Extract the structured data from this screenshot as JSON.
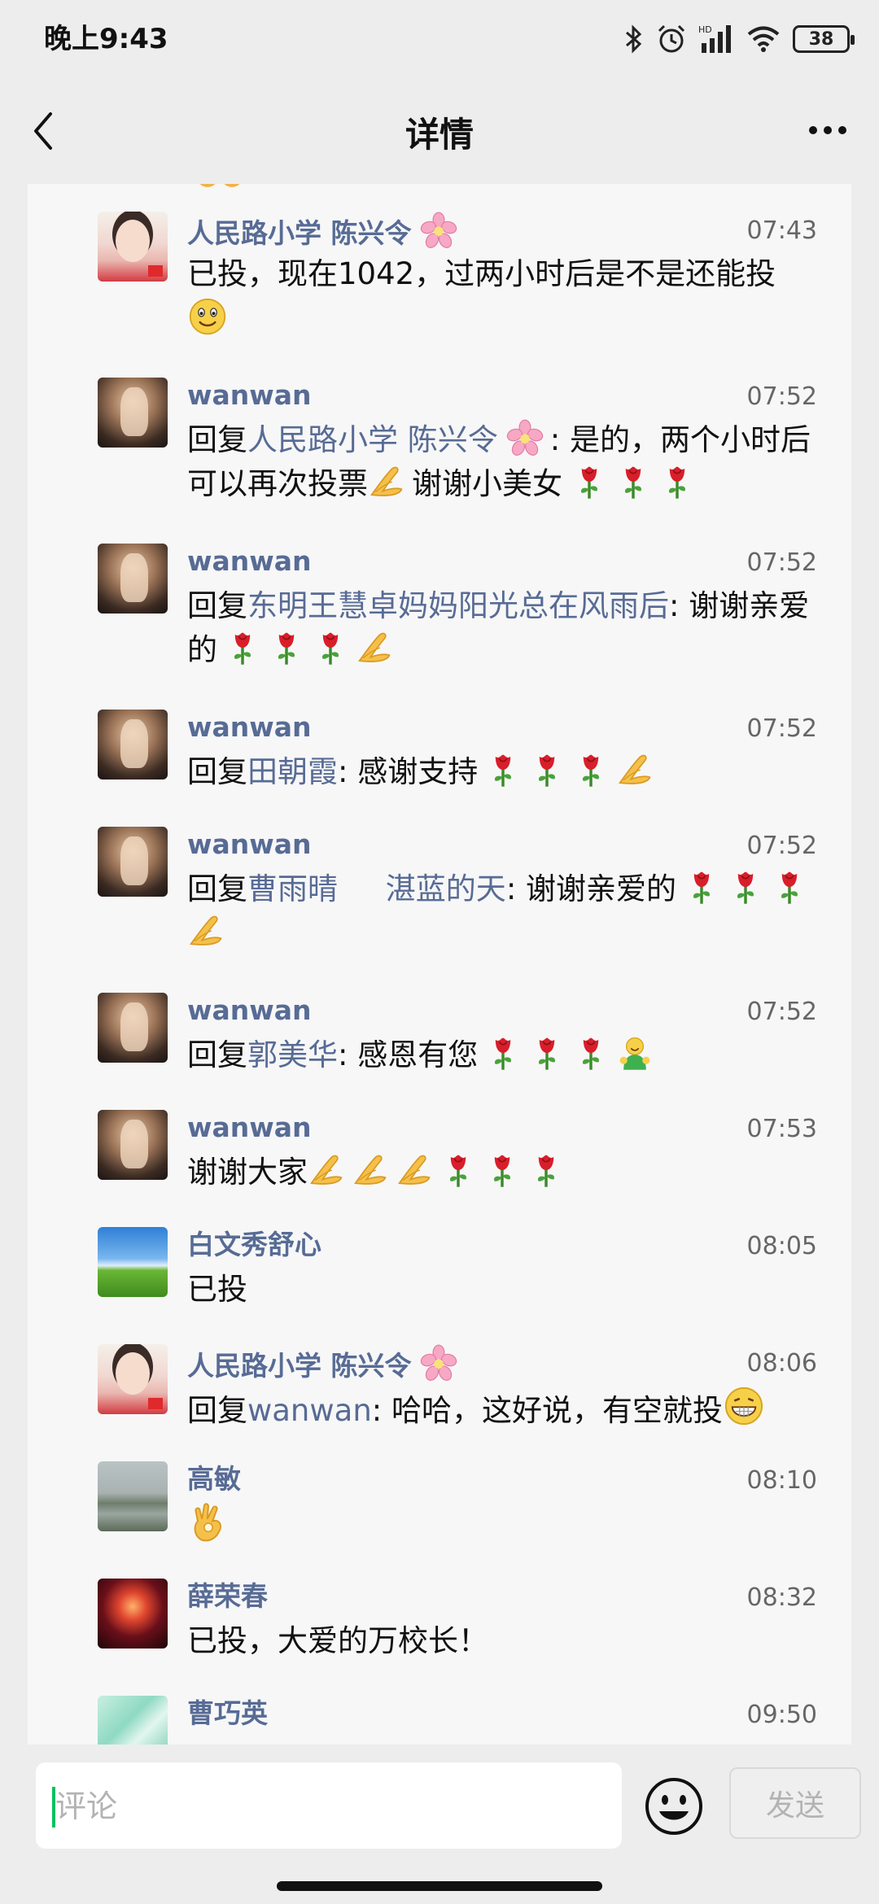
{
  "status_bar": {
    "time": "晚上9:43",
    "battery": "38"
  },
  "header": {
    "title": "详情"
  },
  "comments": [
    {
      "name": "人民路小学 陈兴令",
      "time": "07:43",
      "parts": [
        "已投，现在1042，过两小时后是不是还能投"
      ]
    },
    {
      "name": "wanwan",
      "time": "07:52",
      "parts": [
        "回复",
        "人民路小学 陈兴令",
        ": 是的，两个小时后可以再次投票",
        "谢谢小美女"
      ]
    },
    {
      "name": "wanwan",
      "time": "07:52",
      "parts": [
        "回复",
        "东明王慧卓妈妈阳光总在风雨后",
        ": 谢谢亲爱的"
      ]
    },
    {
      "name": "wanwan",
      "time": "07:52",
      "parts": [
        "回复",
        "田朝霞",
        ": 感谢支持"
      ]
    },
    {
      "name": "wanwan",
      "time": "07:52",
      "parts": [
        "回复",
        "曹雨晴     湛蓝的天",
        ": 谢谢亲爱的"
      ]
    },
    {
      "name": "wanwan",
      "time": "07:52",
      "parts": [
        "回复",
        "郭美华",
        ": 感恩有您"
      ]
    },
    {
      "name": "wanwan",
      "time": "07:53",
      "parts": [
        "谢谢大家"
      ]
    },
    {
      "name": "白文秀舒心",
      "time": "08:05",
      "parts": [
        "已投"
      ]
    },
    {
      "name": "人民路小学 陈兴令",
      "time": "08:06",
      "parts": [
        "回复",
        "wanwan",
        ": 哈哈，这好说，有空就投"
      ]
    },
    {
      "name": "高敏",
      "time": "08:10",
      "parts": []
    },
    {
      "name": "薛荣春",
      "time": "08:32",
      "parts": [
        "已投，大爱的万校长！"
      ]
    },
    {
      "name": "曹巧英",
      "time": "09:50",
      "parts": []
    }
  ],
  "input": {
    "placeholder": "评论",
    "send_label": "发送"
  },
  "icons": [
    "back-icon",
    "more-icon",
    "bluetooth-icon",
    "alarm-icon",
    "signal-icon",
    "wifi-icon",
    "battery-icon",
    "flower-icon",
    "smile-emoji-icon",
    "pray-emoji-icon",
    "rose-emoji-icon",
    "hug-emoji-icon",
    "grin-emoji-icon",
    "ok-hand-emoji-icon",
    "emoji-button-icon"
  ],
  "colors": {
    "link": "#576b95",
    "accent": "#07c160",
    "background": "#ededed"
  }
}
